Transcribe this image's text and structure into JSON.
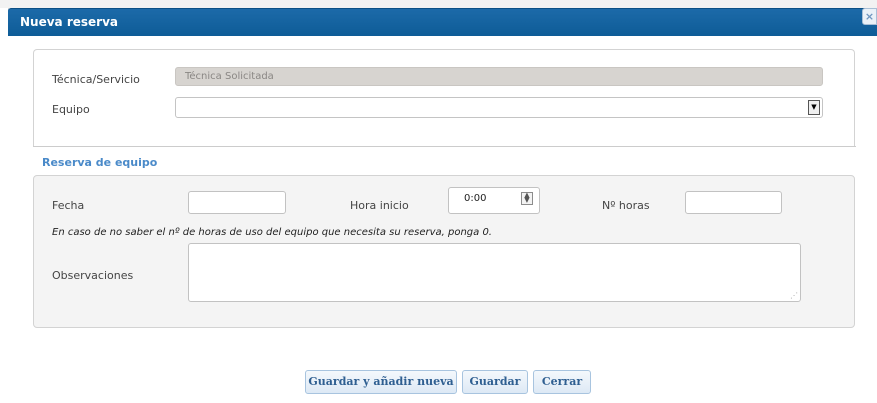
{
  "dialog": {
    "title": "Nueva reserva",
    "close_icon": "×"
  },
  "form": {
    "tecnica_label": "Técnica/Servicio",
    "tecnica_value": "Técnica Solicitada",
    "equipo_label": "Equipo",
    "equipo_value": "",
    "select_arrow": "▼"
  },
  "reserva": {
    "section_title": "Reserva de equipo",
    "fecha_label": "Fecha",
    "fecha_value": "",
    "hora_inicio_label": "Hora inicio",
    "hora_inicio_value": "0:00",
    "spinner_up": "▲",
    "spinner_down": "▼",
    "n_horas_label": "Nº horas",
    "n_horas_value": "",
    "hint": "En caso de no saber el nº de horas de uso del equipo que necesita su reserva, ponga 0.",
    "observaciones_label": "Observaciones",
    "observaciones_value": "",
    "resize_glyph": "⋰"
  },
  "buttons": {
    "save_and_new": "Guardar y añadir nueva",
    "save": "Guardar",
    "close": "Cerrar"
  },
  "colors": {
    "titlebar": "#0e5c97",
    "section_title": "#4a8ac9",
    "button_text": "#2f5f91"
  }
}
